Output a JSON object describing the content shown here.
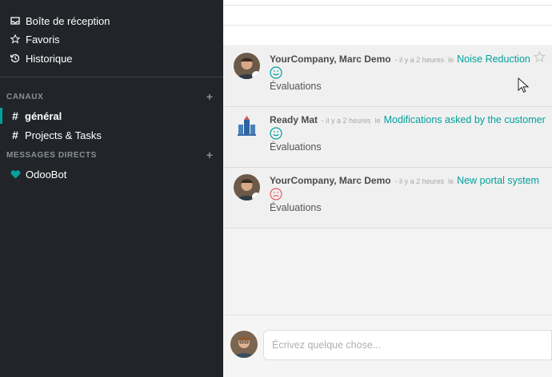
{
  "sidebar": {
    "mailboxes": [
      {
        "label": "Boîte de réception",
        "icon": "inbox-icon"
      },
      {
        "label": "Favoris",
        "icon": "star-icon"
      },
      {
        "label": "Historique",
        "icon": "history-icon"
      }
    ],
    "channels_header": "CANAUX",
    "channels": [
      {
        "label": "général",
        "active": true
      },
      {
        "label": "Projects & Tasks",
        "active": false
      }
    ],
    "dm_header": "MESSAGES DIRECTS",
    "direct_messages": [
      {
        "label": "OdooBot",
        "icon": "heart-icon"
      }
    ]
  },
  "messages": [
    {
      "author": "YourCompany, Marc Demo",
      "time": "- il y a 2 heures",
      "le": "le",
      "record": "Noise Reduction",
      "rating": "happy",
      "body": "Évaluations"
    },
    {
      "author": "Ready Mat",
      "time": "- il y a 2 heures",
      "le": "le",
      "record": "Modifications asked by the customer",
      "rating": "happy",
      "body": "Évaluations"
    },
    {
      "author": "YourCompany, Marc Demo",
      "time": "- il y a 2 heures",
      "le": "le",
      "record": "New portal system",
      "rating": "unhappy",
      "body": "Évaluations"
    }
  ],
  "composer": {
    "placeholder": "Écrivez quelque chose...",
    "value": ""
  },
  "colors": {
    "accent": "#00a09d",
    "sidebar_bg": "#212529",
    "unhappy": "#e35d6a"
  }
}
